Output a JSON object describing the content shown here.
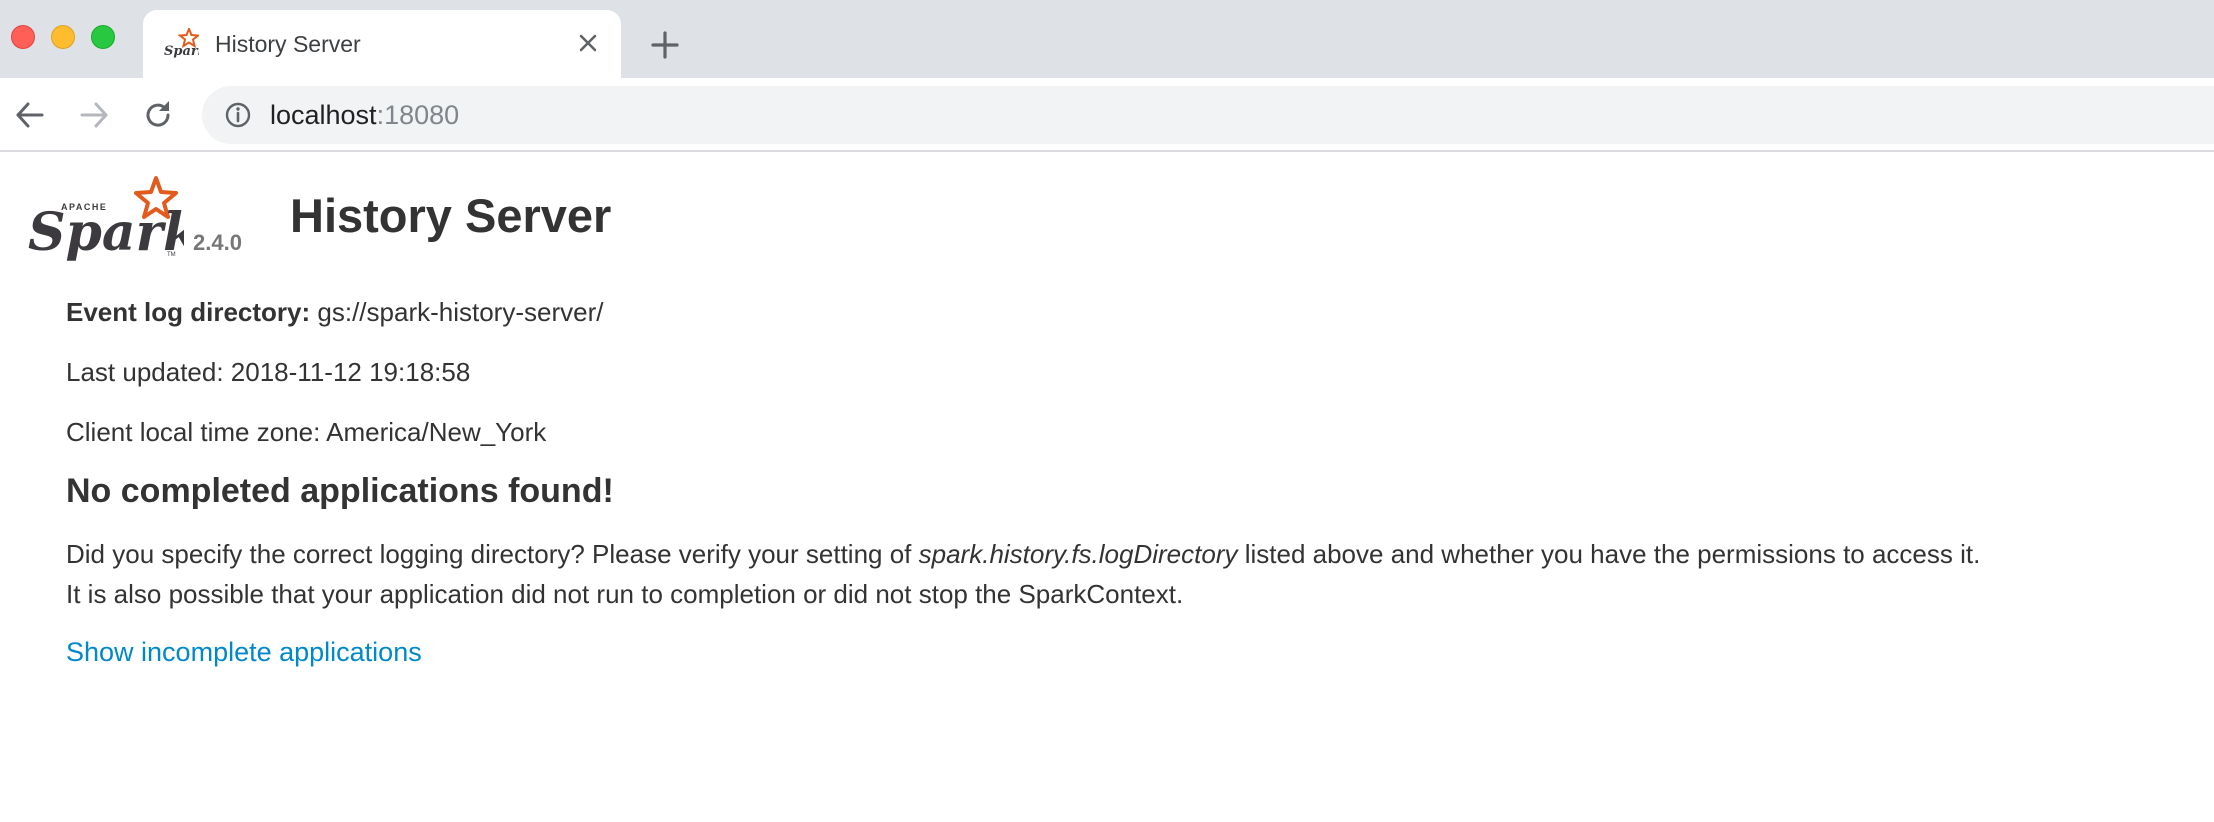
{
  "browser": {
    "tab": {
      "title": "History Server",
      "favicon": "spark-logo-icon"
    },
    "new_tab_icon": "plus-icon",
    "address_bar": {
      "host": "localhost",
      "port": ":18080"
    }
  },
  "page": {
    "logo": {
      "apache_text": "APACHE",
      "spark_text": "Spark",
      "tm": "TM",
      "star_color": "#e25a1c"
    },
    "version": "2.4.0",
    "title": "History Server",
    "event_log": {
      "label": "Event log directory:",
      "value": "gs://spark-history-server/"
    },
    "last_updated": "Last updated: 2018-11-12 19:18:58",
    "time_zone": "Client local time zone: America/New_York",
    "no_apps_heading": "No completed applications found!",
    "description": {
      "part1": "Did you specify the correct logging directory? Please verify your setting of ",
      "setting": "spark.history.fs.logDirectory",
      "part2": " listed above and whether you have the permissions to access it.",
      "line2": "It is also possible that your application did not run to completion or did not stop the SparkContext."
    },
    "show_incomplete_link": "Show incomplete applications",
    "link_color": "#0088cc"
  }
}
